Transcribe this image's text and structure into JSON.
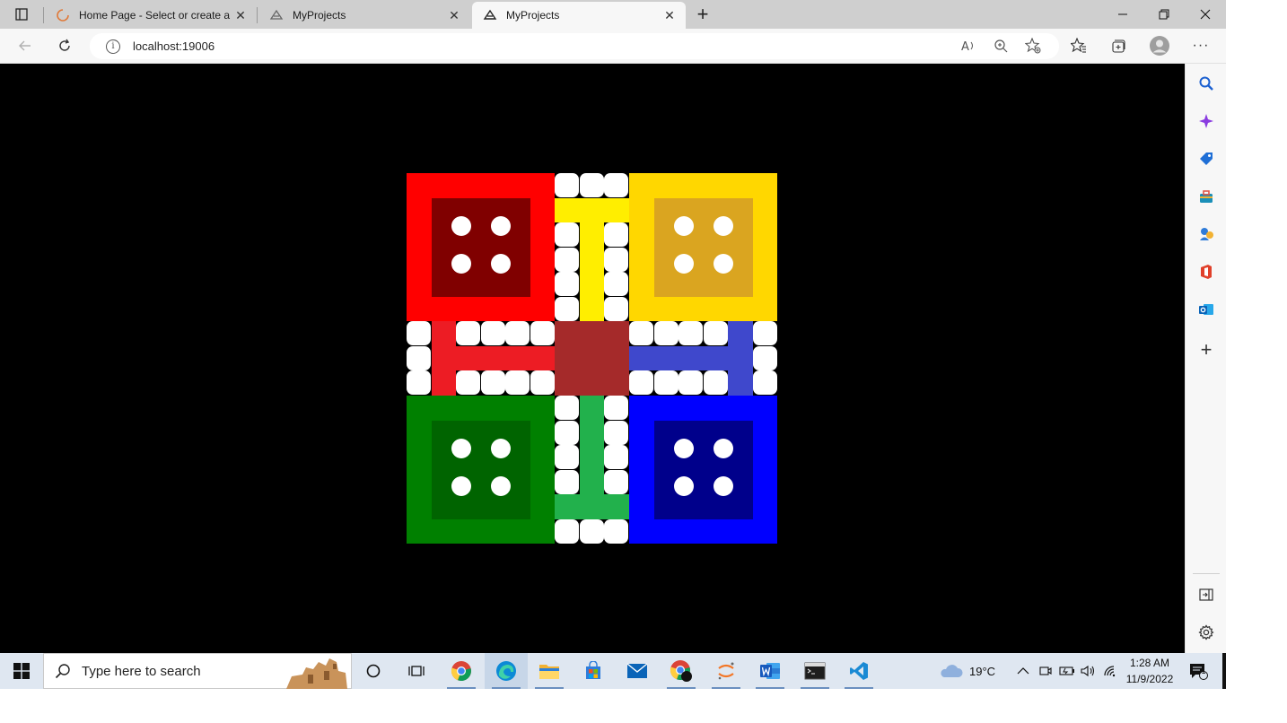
{
  "browser": {
    "tabs": [
      {
        "title": "Home Page - Select or create a n",
        "active": false
      },
      {
        "title": "MyProjects",
        "active": false
      },
      {
        "title": "MyProjects",
        "active": true
      }
    ],
    "address": {
      "url": "localhost:19006"
    }
  },
  "board": {
    "colors": {
      "red": "#ff0000",
      "red_inner": "#800000",
      "yellow": "#ffd700",
      "yellow_inner": "#daa520",
      "green": "#008000",
      "green_inner": "#006400",
      "blue": "#0000ff",
      "blue_inner": "#00008b",
      "red_lane": "#ed1c24",
      "yellow_lane": "#ffee00",
      "green_lane": "#22b14c",
      "blue_lane": "#3f48cc",
      "center": "#a52a2a"
    }
  },
  "sidebar": {
    "icons": [
      "search-icon",
      "copilot-icon",
      "shopping-icon",
      "tools-icon",
      "games-icon",
      "office-icon",
      "outlook-icon",
      "add-icon",
      "split-screen-icon",
      "settings-icon"
    ]
  },
  "taskbar": {
    "search_placeholder": "Type here to search",
    "weather": {
      "temperature": "19°C"
    },
    "clock": {
      "time": "1:28 AM",
      "date": "11/9/2022"
    },
    "notifications_count": "1"
  }
}
